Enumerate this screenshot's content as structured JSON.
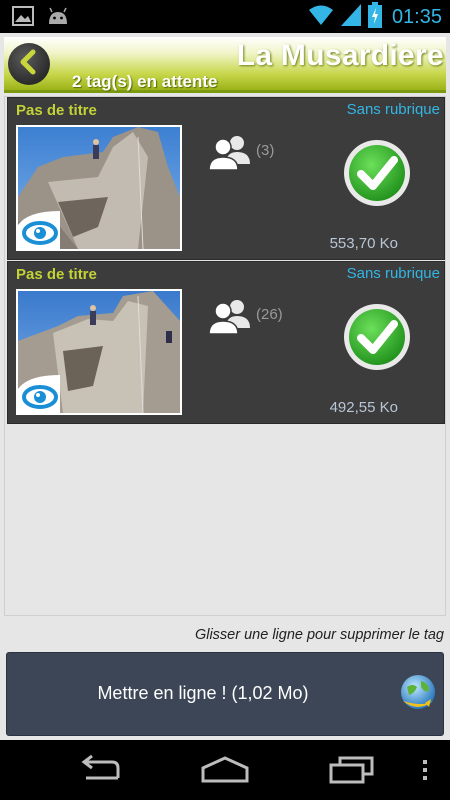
{
  "status_bar": {
    "time": "01:35",
    "icons": [
      "image-icon",
      "android-icon",
      "wifi-icon",
      "signal-icon",
      "battery-icon"
    ]
  },
  "header": {
    "title": "La Musardiere",
    "pending_tags": "2 tag(s) en attente",
    "back_icon": "back-arrow-icon"
  },
  "tags": [
    {
      "title": "Pas de titre",
      "rubric": "Sans rubrique",
      "persons_count": "(3)",
      "size": "553,70 Ko"
    },
    {
      "title": "Pas de titre",
      "rubric": "Sans rubrique",
      "persons_count": "(26)",
      "size": "492,55 Ko"
    }
  ],
  "hint": "Glisser une ligne pour supprimer le tag",
  "publish": {
    "label": "Mettre en ligne ! (1,02 Mo)",
    "icon": "globe-upload-icon"
  },
  "nav_bar": {
    "icons": [
      "back-nav-icon",
      "home-nav-icon",
      "recents-nav-icon",
      "menu-overflow-icon"
    ]
  },
  "colors": {
    "accent_green": "#9cb318",
    "title_lime": "#c2d237",
    "rubric_blue": "#33b5e5",
    "row_bg": "#3c3c3c",
    "button_bg": "#3c4656"
  }
}
